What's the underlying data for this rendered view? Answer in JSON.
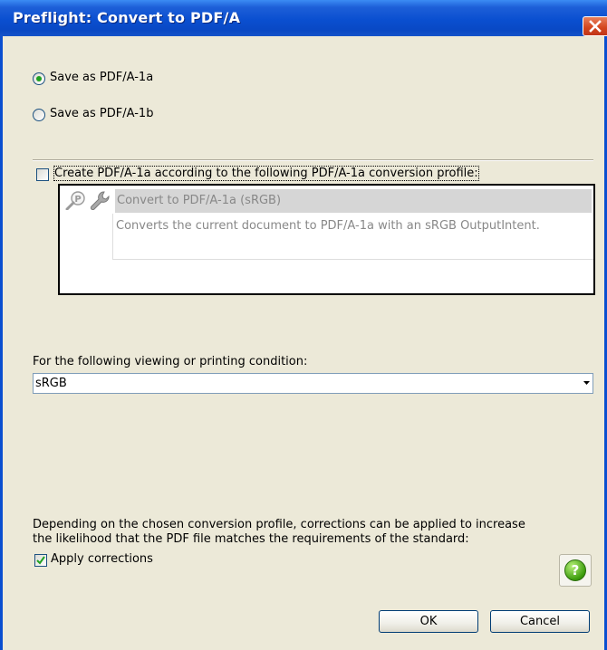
{
  "window": {
    "title": "Preflight: Convert to PDF/A"
  },
  "options": {
    "save_a1a_label": "Save as PDF/A-1a",
    "save_a1b_label": "Save as PDF/A-1b",
    "selected": "Save as PDF/A-1a"
  },
  "profile": {
    "checkbox_label": "Create PDF/A-1a according to the following PDF/A-1a conversion profile:",
    "checked": false,
    "name": "Convert to PDF/A-1a (sRGB)",
    "description": "Converts the current document to PDF/A-1a with an sRGB OutputIntent.",
    "icons": [
      "magnifier-icon",
      "wrench-icon"
    ]
  },
  "condition": {
    "label": "For the following viewing or printing condition:",
    "selected_value": "sRGB"
  },
  "corrections": {
    "info_line1": "Depending on the chosen conversion profile, corrections can be applied to increase",
    "info_line2": "the likelihood that the PDF file matches the requirements of the standard:",
    "checkbox_label": "Apply corrections",
    "checked": true
  },
  "help": {
    "glyph": "?"
  },
  "buttons": {
    "ok": "OK",
    "cancel": "Cancel"
  },
  "colors": {
    "titlebar": "#0a4fd0",
    "dialog_bg": "#ece9d8",
    "close": "#d3441c",
    "radio_dot": "#21a121",
    "help": "#3c9c0c"
  }
}
